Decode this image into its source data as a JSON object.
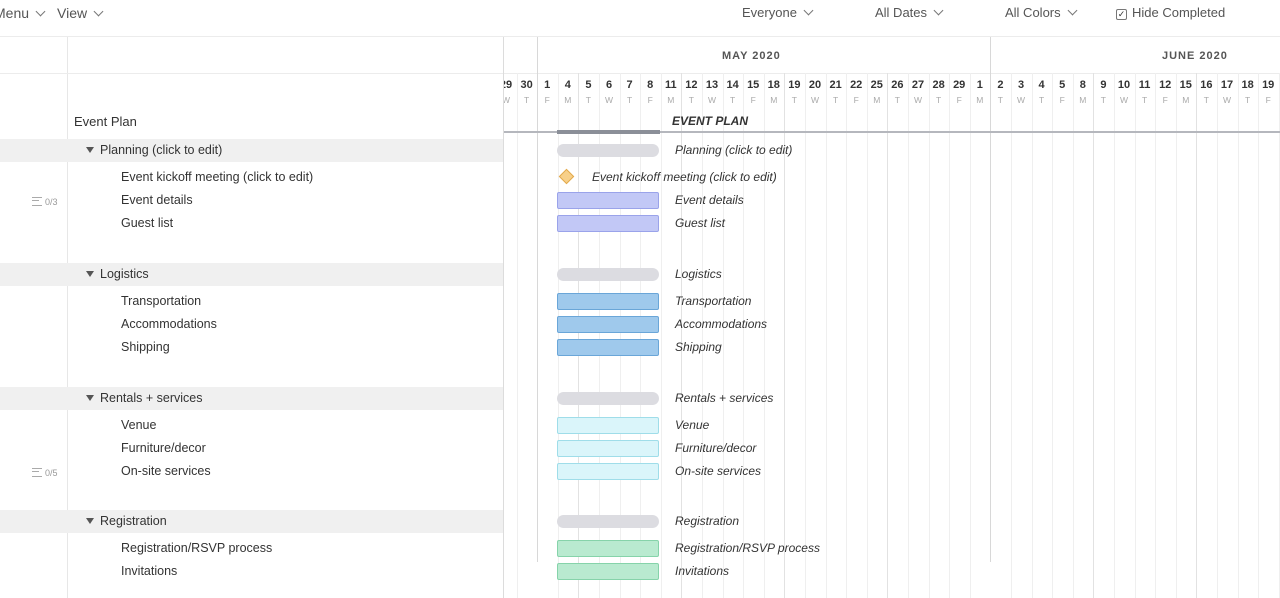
{
  "toolbar": {
    "menu_label": "Menu",
    "view_label": "View",
    "everyone_label": "Everyone",
    "all_dates_label": "All Dates",
    "all_colors_label": "All Colors",
    "hide_completed_label": "Hide Completed",
    "hide_completed_checked": true
  },
  "project": {
    "title": "Event Plan",
    "gantt_title": "EVENT PLAN"
  },
  "timeline": {
    "months": [
      "MAY 2020",
      "JUNE 2020"
    ],
    "days": [
      {
        "n": "29",
        "d": "W"
      },
      {
        "n": "30",
        "d": "T"
      },
      {
        "n": "1",
        "d": "F"
      },
      {
        "n": "4",
        "d": "M"
      },
      {
        "n": "5",
        "d": "T"
      },
      {
        "n": "6",
        "d": "W"
      },
      {
        "n": "7",
        "d": "T"
      },
      {
        "n": "8",
        "d": "F"
      },
      {
        "n": "11",
        "d": "M"
      },
      {
        "n": "12",
        "d": "T"
      },
      {
        "n": "13",
        "d": "W"
      },
      {
        "n": "14",
        "d": "T"
      },
      {
        "n": "15",
        "d": "F"
      },
      {
        "n": "18",
        "d": "M"
      },
      {
        "n": "19",
        "d": "T"
      },
      {
        "n": "20",
        "d": "W"
      },
      {
        "n": "21",
        "d": "T"
      },
      {
        "n": "22",
        "d": "F"
      },
      {
        "n": "25",
        "d": "M"
      },
      {
        "n": "26",
        "d": "T"
      },
      {
        "n": "27",
        "d": "W"
      },
      {
        "n": "28",
        "d": "T"
      },
      {
        "n": "29",
        "d": "F"
      },
      {
        "n": "1",
        "d": "M"
      },
      {
        "n": "2",
        "d": "T"
      },
      {
        "n": "3",
        "d": "W"
      },
      {
        "n": "4",
        "d": "T"
      },
      {
        "n": "5",
        "d": "F"
      },
      {
        "n": "8",
        "d": "M"
      },
      {
        "n": "9",
        "d": "T"
      },
      {
        "n": "10",
        "d": "W"
      },
      {
        "n": "11",
        "d": "T"
      },
      {
        "n": "12",
        "d": "F"
      },
      {
        "n": "15",
        "d": "M"
      },
      {
        "n": "16",
        "d": "T"
      },
      {
        "n": "17",
        "d": "W"
      },
      {
        "n": "18",
        "d": "T"
      },
      {
        "n": "19",
        "d": "F"
      }
    ]
  },
  "groups": [
    {
      "name": "Planning (click to edit)",
      "bar_color": "#dcdce1",
      "tasks": [
        {
          "name": "Event kickoff meeting (click to edit)",
          "type": "milestone"
        },
        {
          "name": "Event details",
          "type": "task",
          "color": "#c2c8f6",
          "border": "#9aa3ea",
          "badge": "0/3"
        },
        {
          "name": "Guest list",
          "type": "task",
          "color": "#c2c8f6",
          "border": "#9aa3ea"
        }
      ]
    },
    {
      "name": "Logistics",
      "bar_color": "#dcdce1",
      "tasks": [
        {
          "name": "Transportation",
          "type": "task",
          "color": "#9fc9ec",
          "border": "#6aa6d8"
        },
        {
          "name": "Accommodations",
          "type": "task",
          "color": "#9fc9ec",
          "border": "#6aa6d8"
        },
        {
          "name": "Shipping",
          "type": "task",
          "color": "#9fc9ec",
          "border": "#6aa6d8"
        }
      ]
    },
    {
      "name": "Rentals + services",
      "bar_color": "#dcdce1",
      "tasks": [
        {
          "name": "Venue",
          "type": "task",
          "color": "#daf5fa",
          "border": "#9fdde9"
        },
        {
          "name": "Furniture/decor",
          "type": "task",
          "color": "#daf5fa",
          "border": "#9fdde9"
        },
        {
          "name": "On-site services",
          "type": "task",
          "color": "#daf5fa",
          "border": "#9fdde9",
          "badge": "0/5"
        }
      ]
    },
    {
      "name": "Registration",
      "bar_color": "#dcdce1",
      "tasks": [
        {
          "name": "Registration/RSVP process",
          "type": "task",
          "color": "#b9ead0",
          "border": "#86d3aa"
        },
        {
          "name": "Invitations",
          "type": "task",
          "color": "#b9ead0",
          "border": "#86d3aa"
        }
      ]
    }
  ]
}
